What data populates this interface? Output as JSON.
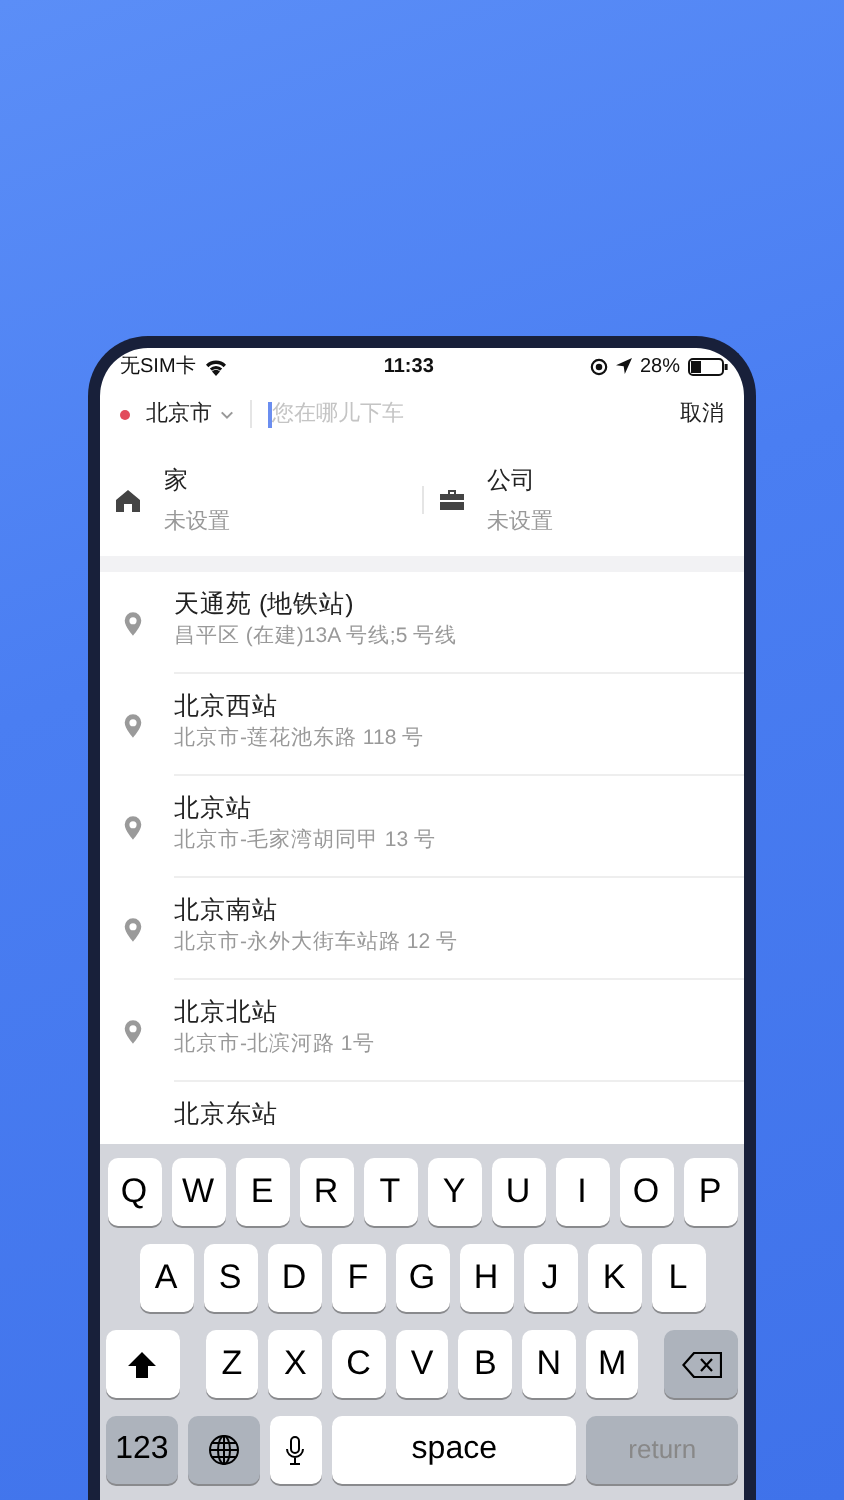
{
  "status_bar": {
    "carrier": "无SIM卡",
    "time": "11:33",
    "battery": "28%"
  },
  "search": {
    "city": "北京市",
    "placeholder": "您在哪儿下车",
    "cancel": "取消"
  },
  "shortcuts": [
    {
      "kind": "home",
      "label": "家",
      "value": "未设置"
    },
    {
      "kind": "work",
      "label": "公司",
      "value": "未设置"
    }
  ],
  "places": [
    {
      "name": "天通苑 (地铁站)",
      "address": "昌平区 (在建)13A 号线;5 号线"
    },
    {
      "name": "北京西站",
      "address": "北京市-莲花池东路 118 号"
    },
    {
      "name": "北京站",
      "address": "北京市-毛家湾胡同甲 13 号"
    },
    {
      "name": "北京南站",
      "address": "北京市-永外大街车站路 12 号"
    },
    {
      "name": "北京北站",
      "address": "北京市-北滨河路 1号"
    },
    {
      "name": "北京东站"
    }
  ],
  "keyboard": [
    [
      {
        "kind": "letter",
        "label": "Q"
      },
      {
        "kind": "letter",
        "label": "W"
      },
      {
        "kind": "letter",
        "label": "E"
      },
      {
        "kind": "letter",
        "label": "R"
      },
      {
        "kind": "letter",
        "label": "T"
      },
      {
        "kind": "letter",
        "label": "Y"
      },
      {
        "kind": "letter",
        "label": "U"
      },
      {
        "kind": "letter",
        "label": "I"
      },
      {
        "kind": "letter",
        "label": "O"
      },
      {
        "kind": "letter",
        "label": "P"
      }
    ],
    [
      {
        "kind": "letter",
        "label": "A"
      },
      {
        "kind": "letter",
        "label": "S"
      },
      {
        "kind": "letter",
        "label": "D"
      },
      {
        "kind": "letter",
        "label": "F"
      },
      {
        "kind": "letter",
        "label": "G"
      },
      {
        "kind": "letter",
        "label": "H"
      },
      {
        "kind": "letter",
        "label": "J"
      },
      {
        "kind": "letter",
        "label": "K"
      },
      {
        "kind": "letter",
        "label": "L"
      }
    ],
    [
      {
        "kind": "shift"
      },
      {
        "kind": "letter",
        "label": "Z"
      },
      {
        "kind": "letter",
        "label": "X"
      },
      {
        "kind": "letter",
        "label": "C"
      },
      {
        "kind": "letter",
        "label": "V"
      },
      {
        "kind": "letter",
        "label": "B"
      },
      {
        "kind": "letter",
        "label": "N"
      },
      {
        "kind": "letter",
        "label": "M"
      },
      {
        "kind": "delete"
      }
    ],
    [
      {
        "kind": "numbers",
        "label": "123"
      },
      {
        "kind": "globe"
      },
      {
        "kind": "mic"
      },
      {
        "kind": "space",
        "label": "space"
      },
      {
        "kind": "return",
        "label": "return"
      }
    ]
  ]
}
